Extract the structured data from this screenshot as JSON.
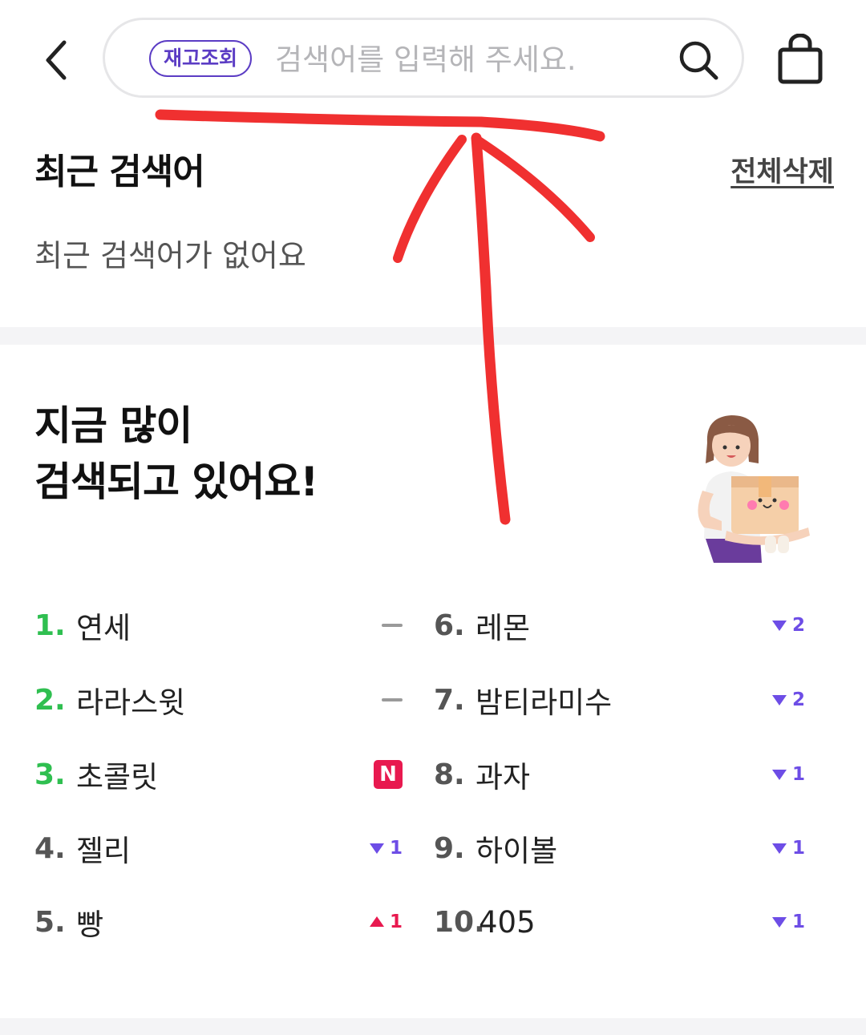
{
  "header": {
    "stock_chip": "재고조회",
    "search_placeholder": "검색어를 입력해 주세요."
  },
  "recent": {
    "title": "최근 검색어",
    "delete_all": "전체삭제",
    "empty_message": "최근 검색어가 없어요"
  },
  "popular": {
    "title_line1": "지금 많이",
    "title_line2": "검색되고 있어요!",
    "ranks": [
      {
        "num": "1.",
        "keyword": "연세",
        "change_type": "same",
        "change": ""
      },
      {
        "num": "2.",
        "keyword": "라라스윗",
        "change_type": "same",
        "change": ""
      },
      {
        "num": "3.",
        "keyword": "초콜릿",
        "change_type": "new",
        "change": "N"
      },
      {
        "num": "4.",
        "keyword": "젤리",
        "change_type": "down",
        "change": "1"
      },
      {
        "num": "5.",
        "keyword": "빵",
        "change_type": "up",
        "change": "1"
      },
      {
        "num": "6.",
        "keyword": "레몬",
        "change_type": "down",
        "change": "2"
      },
      {
        "num": "7.",
        "keyword": "밤티라미수",
        "change_type": "down",
        "change": "2"
      },
      {
        "num": "8.",
        "keyword": "과자",
        "change_type": "down",
        "change": "1"
      },
      {
        "num": "9.",
        "keyword": "하이볼",
        "change_type": "down",
        "change": "1"
      },
      {
        "num": "10.",
        "keyword": "405",
        "change_type": "down",
        "change": "1"
      }
    ]
  },
  "colors": {
    "accent_purple": "#5b3cc4",
    "rank_top_green": "#2fbf50",
    "down_purple": "#6d4de6",
    "up_red": "#e8194f",
    "annotation_red": "#f03030"
  }
}
